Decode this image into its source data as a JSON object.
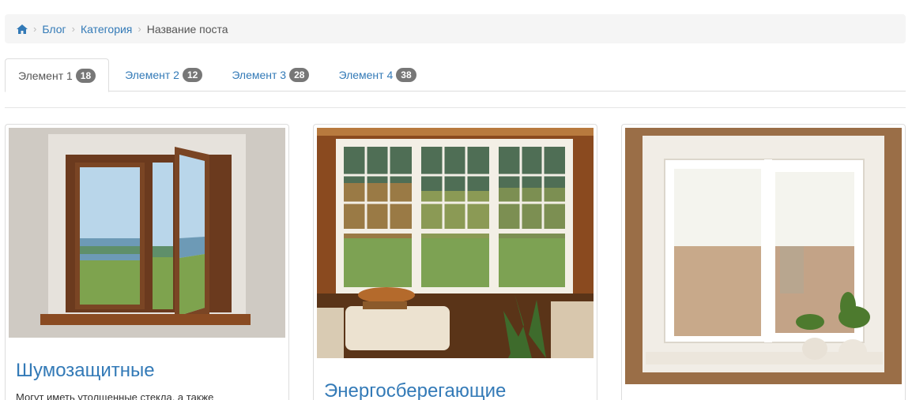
{
  "breadcrumb": {
    "home_icon": "home-icon",
    "items": [
      "Блог",
      "Категория"
    ],
    "current": "Название поста"
  },
  "tabs": [
    {
      "label": "Элемент 1",
      "count": "18",
      "active": true
    },
    {
      "label": "Элемент 2",
      "count": "12",
      "active": false
    },
    {
      "label": "Элемент 3",
      "count": "28",
      "active": false
    },
    {
      "label": "Элемент 4",
      "count": "38",
      "active": false
    }
  ],
  "cards": [
    {
      "title": "Шумозащитные",
      "text": "Могут иметь утолщенные стекла, а также"
    },
    {
      "title": "Энергосберегающие",
      "text": ""
    },
    {
      "title": "",
      "text": ""
    }
  ],
  "colors": {
    "link": "#337ab7",
    "badge": "#777777",
    "breadcrumb_bg": "#f5f5f5"
  }
}
